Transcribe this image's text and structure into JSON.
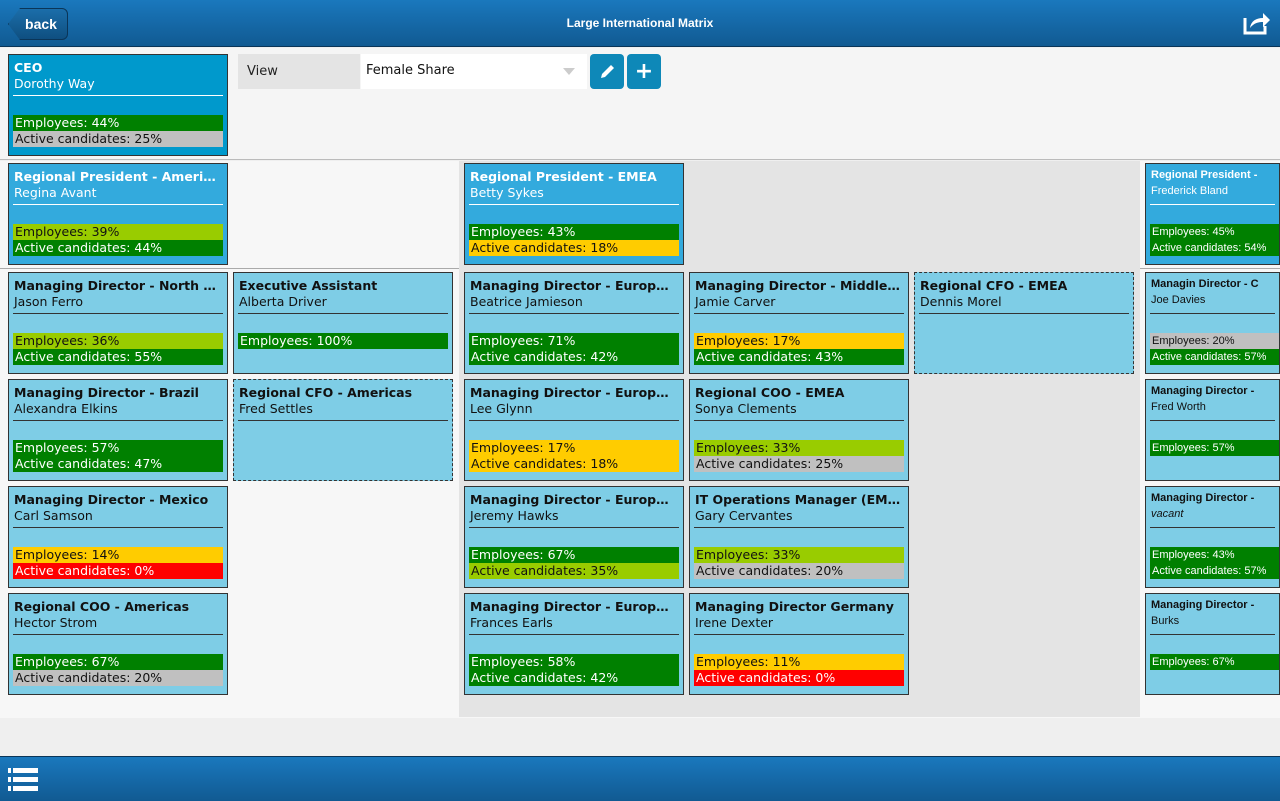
{
  "header": {
    "back_label": "back",
    "title": "Large International Matrix",
    "share_icon": "share-icon"
  },
  "toolbar": {
    "view_label": "View",
    "view_value": "Female Share",
    "edit_icon": "pencil-icon",
    "add_icon": "plus-icon"
  },
  "colors": {
    "green": "#008000",
    "lime": "#99cc00",
    "yellow": "#ffcc00",
    "gray": "#c0c0c0",
    "red": "#ff0000",
    "ceo_card": "#0099cc",
    "president_card": "#33aadd",
    "position_card": "#7ecde6"
  },
  "ceo": {
    "title": "CEO",
    "name": "Dorothy Way",
    "bars": [
      {
        "label": "Employees: 44%",
        "status": "green"
      },
      {
        "label": "Active candidates: 25%",
        "status": "gray"
      }
    ]
  },
  "regions": [
    {
      "president": {
        "title": "Regional President - Americas",
        "name": "Regina Avant",
        "bars": [
          {
            "label": "Employees: 39%",
            "status": "lime"
          },
          {
            "label": "Active candidates: 44%",
            "status": "green"
          }
        ]
      },
      "columns": [
        [
          {
            "title": "Managing Director - North America",
            "name": "Jason Ferro",
            "bars": [
              {
                "label": "Employees: 36%",
                "status": "lime"
              },
              {
                "label": "Active candidates: 55%",
                "status": "green"
              }
            ]
          },
          {
            "title": "Managing Director - Brazil",
            "name": "Alexandra Elkins",
            "bars": [
              {
                "label": "Employees: 57%",
                "status": "green"
              },
              {
                "label": "Active candidates: 47%",
                "status": "green"
              }
            ]
          },
          {
            "title": "Managing Director - Mexico",
            "name": "Carl Samson",
            "bars": [
              {
                "label": "Employees: 14%",
                "status": "yellow"
              },
              {
                "label": "Active candidates: 0%",
                "status": "red"
              }
            ]
          },
          {
            "title": "Regional COO - Americas",
            "name": "Hector Strom",
            "bars": [
              {
                "label": "Employees: 67%",
                "status": "green"
              },
              {
                "label": "Active candidates: 20%",
                "status": "gray"
              }
            ]
          }
        ],
        [
          {
            "title": "Executive Assistant",
            "name": "Alberta Driver",
            "bars": [
              {
                "label": "Employees: 100%",
                "status": "green"
              }
            ]
          },
          {
            "title": "Regional CFO - Americas",
            "name": "Fred Settles",
            "dashed": true,
            "bars": []
          }
        ]
      ]
    },
    {
      "president": {
        "title": "Regional President - EMEA",
        "name": "Betty Sykes",
        "bars": [
          {
            "label": "Employees: 43%",
            "status": "green"
          },
          {
            "label": "Active candidates: 18%",
            "status": "yellow"
          }
        ]
      },
      "columns": [
        [
          {
            "title": "Managing Director - Europe North",
            "name": "Beatrice Jamieson",
            "bars": [
              {
                "label": "Employees: 71%",
                "status": "green"
              },
              {
                "label": "Active candidates: 42%",
                "status": "green"
              }
            ]
          },
          {
            "title": "Managing Director - Europe East",
            "name": "Lee Glynn",
            "bars": [
              {
                "label": "Employees: 17%",
                "status": "yellow"
              },
              {
                "label": "Active candidates: 18%",
                "status": "yellow"
              }
            ]
          },
          {
            "title": "Managing Director - Europe South",
            "name": "Jeremy Hawks",
            "bars": [
              {
                "label": "Employees: 67%",
                "status": "green"
              },
              {
                "label": "Active candidates: 35%",
                "status": "lime"
              }
            ]
          },
          {
            "title": "Managing Director - Europe West",
            "name": "Frances Earls",
            "bars": [
              {
                "label": "Employees: 58%",
                "status": "green"
              },
              {
                "label": "Active candidates: 42%",
                "status": "green"
              }
            ]
          }
        ],
        [
          {
            "title": "Managing Director - Middle East",
            "name": "Jamie Carver",
            "bars": [
              {
                "label": "Employees: 17%",
                "status": "yellow"
              },
              {
                "label": "Active candidates: 43%",
                "status": "green"
              }
            ]
          },
          {
            "title": "Regional COO - EMEA",
            "name": "Sonya Clements",
            "bars": [
              {
                "label": "Employees: 33%",
                "status": "lime"
              },
              {
                "label": "Active candidates: 25%",
                "status": "gray"
              }
            ]
          },
          {
            "title": "IT Operations Manager (EMEA)",
            "name": "Gary Cervantes",
            "bars": [
              {
                "label": "Employees: 33%",
                "status": "lime"
              },
              {
                "label": "Active candidates: 20%",
                "status": "gray"
              }
            ]
          },
          {
            "title": "Managing Director Germany",
            "name": "Irene Dexter",
            "bars": [
              {
                "label": "Employees: 11%",
                "status": "yellow"
              },
              {
                "label": "Active candidates: 0%",
                "status": "red"
              }
            ]
          }
        ],
        [
          {
            "title": "Regional CFO - EMEA",
            "name": "Dennis Morel",
            "dashed": true,
            "bars": []
          }
        ]
      ]
    },
    {
      "president": {
        "title": "Regional President - ",
        "name": "Frederick Bland",
        "bars": [
          {
            "label": "Employees: 45%",
            "status": "green"
          },
          {
            "label": "Active candidates: 54%",
            "status": "green"
          }
        ]
      },
      "columns": [
        [
          {
            "title": "Managin Director - C",
            "name": "Joe Davies",
            "bars": [
              {
                "label": "Employees: 20%",
                "status": "gray"
              },
              {
                "label": "Active candidates: 57%",
                "status": "green"
              }
            ]
          },
          {
            "title": "Managing Director - ",
            "name": "Fred Worth",
            "bars": [
              {
                "label": "Employees: 57%",
                "status": "green"
              }
            ]
          },
          {
            "title": "Managing Director - ",
            "name": "vacant",
            "vacant": true,
            "bars": [
              {
                "label": "Employees: 43%",
                "status": "green"
              },
              {
                "label": "Active candidates: 57%",
                "status": "green"
              }
            ]
          },
          {
            "title": "Managing Director - ",
            "name": "Burks",
            "bars": [
              {
                "label": "Employees: 67%",
                "status": "green"
              }
            ]
          }
        ]
      ]
    }
  ],
  "footer": {
    "menu_icon": "list-icon"
  }
}
